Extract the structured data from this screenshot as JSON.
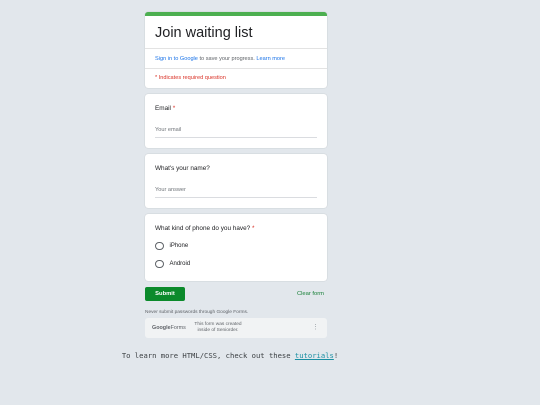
{
  "form": {
    "title": "Join waiting list",
    "signin_link": "Sign in to Google",
    "signin_text": " to save your progress. ",
    "learn_more": "Learn more",
    "required_note": "* Indicates required question"
  },
  "questions": [
    {
      "title": "Email",
      "required": "*",
      "input_placeholder": "Your email"
    },
    {
      "title": "What's your name?",
      "input_placeholder": "Your answer"
    },
    {
      "title": "What kind of phone do you have?",
      "required": "*",
      "options": [
        "iPhone",
        "Android"
      ]
    }
  ],
  "actions": {
    "submit": "Submit",
    "clear": "Clear form"
  },
  "password_note": "Never submit passwords through Google Forms.",
  "footer": {
    "logo_google": "Google",
    "logo_forms": "Forms",
    "text": "This form was created inside of Seniorder.",
    "more_icon": "⋮"
  },
  "bottom": {
    "prefix": "To learn more HTML/CSS, check out these ",
    "link": "tutorials",
    "suffix": "!"
  },
  "colors": {
    "accent": "#4caf50",
    "submit": "#0b8a2b",
    "required": "#d93025",
    "link": "#1a73e8"
  }
}
